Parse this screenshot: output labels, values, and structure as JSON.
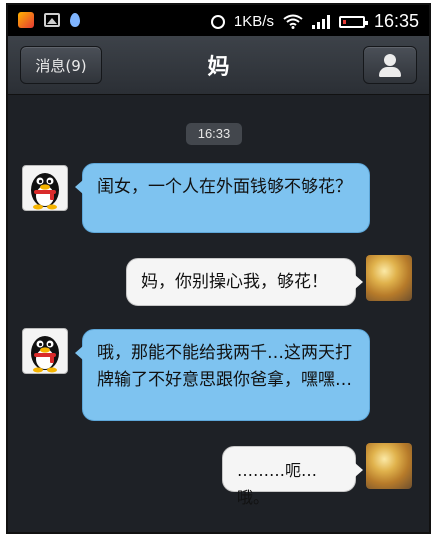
{
  "status_bar": {
    "network_speed": "1KB/s",
    "time": "16:35",
    "icons": [
      "app-notification-icon",
      "image-icon",
      "water-drop-icon",
      "alarm-icon",
      "wifi-icon",
      "signal-icon",
      "battery-icon"
    ],
    "battery_color": "#e53935"
  },
  "header": {
    "back_label": "消息(9)",
    "title": "妈",
    "profile_icon": "person-icon"
  },
  "chat": {
    "timestamp": "16:33",
    "messages": [
      {
        "sender": "mom",
        "text": "闺女，一个人在外面钱够不够花？"
      },
      {
        "sender": "me",
        "text": "妈，你别操心我，够花！"
      },
      {
        "sender": "mom",
        "text": "哦，那能不能给我两千…这两天打牌输了不好意思跟你爸拿，嘿嘿…"
      },
      {
        "sender": "me",
        "text": "………呃…哦。"
      }
    ]
  },
  "colors": {
    "incoming_bubble": "#7ec3f0",
    "outgoing_bubble": "#f5f5f5",
    "background": "#1e2126"
  }
}
